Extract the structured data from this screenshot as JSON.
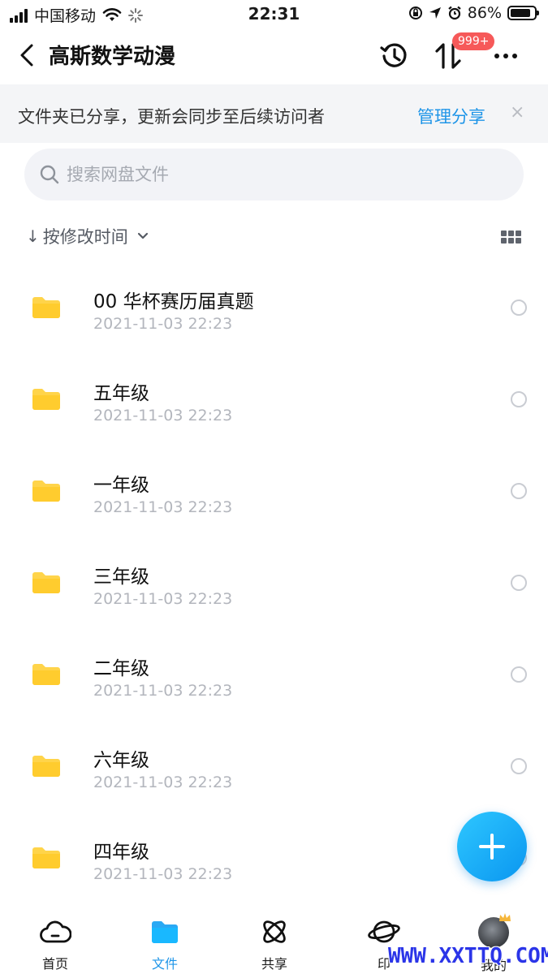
{
  "status_bar": {
    "carrier": "中国移动",
    "time": "22:31",
    "battery": "86%",
    "battery_level": 0.86
  },
  "nav": {
    "title": "高斯数学动漫",
    "transfer_badge": "999+"
  },
  "share_banner": {
    "message": "文件夹已分享，更新会同步至后续访问者",
    "manage_label": "管理分享",
    "close_glyph": "×"
  },
  "search": {
    "placeholder": "搜索网盘文件"
  },
  "sort": {
    "arrow": "↓",
    "label": "按修改时间"
  },
  "files": [
    {
      "name": "00  华杯赛历届真题",
      "modified": "2021-11-03 22:23"
    },
    {
      "name": "五年级",
      "modified": "2021-11-03 22:23"
    },
    {
      "name": "一年级",
      "modified": "2021-11-03 22:23"
    },
    {
      "name": "三年级",
      "modified": "2021-11-03 22:23"
    },
    {
      "name": "二年级",
      "modified": "2021-11-03 22:23"
    },
    {
      "name": "六年级",
      "modified": "2021-11-03 22:23"
    },
    {
      "name": "四年级",
      "modified": "2021-11-03 22:23"
    }
  ],
  "tabs": [
    {
      "label": "首页",
      "icon": "cloud-icon"
    },
    {
      "label": "文件",
      "icon": "folder-icon"
    },
    {
      "label": "共享",
      "icon": "atom-icon"
    },
    {
      "label": "印",
      "icon": "planet-icon"
    },
    {
      "label": "我的",
      "icon": "avatar"
    }
  ],
  "watermark": "WWW.XXTTQ.COM",
  "colors": {
    "accent": "#1e95e8",
    "folder": "#ffd44a",
    "badge": "#f65959",
    "fab": "#0a96f0"
  }
}
